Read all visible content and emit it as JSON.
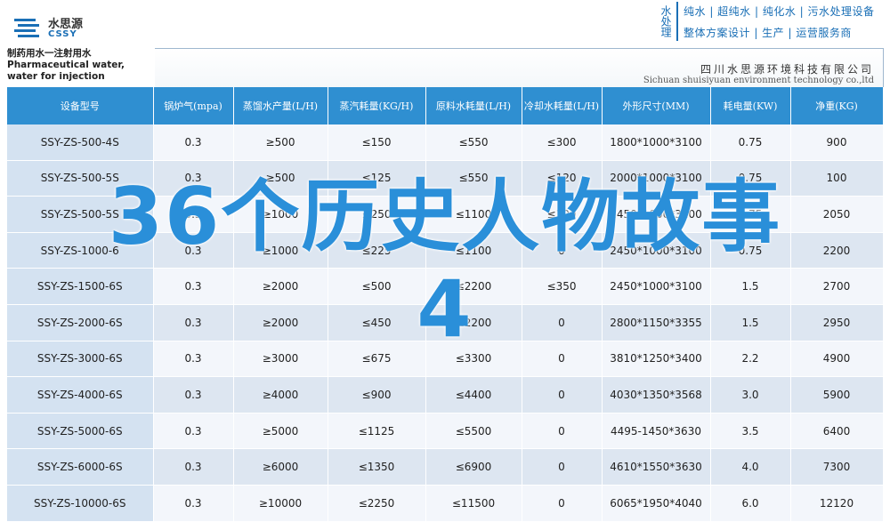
{
  "brand": {
    "name_cn": "水思源",
    "name_en": "CSSY"
  },
  "header": {
    "side_tag": "水处理",
    "line1": "纯水 | 超纯水 | 纯化水 | 污水处理设备",
    "line2": "整体方案设计 | 生产 | 运营服务商"
  },
  "product": {
    "title_cn": "制药用水一注射用水",
    "title_en": "Pharmaceutical water, water for injection",
    "company_cn": "四川水思源环境科技有限公司",
    "company_en": "Sichuan shuisiyuan environment technology co.,ltd"
  },
  "table": {
    "headers": [
      "设备型号",
      "锅炉气(mpa)",
      "蒸馏水产量(L/H)",
      "蒸汽耗量(KG/H)",
      "原料水耗量(L/H)",
      "冷却水耗量(L/H)",
      "外形尺寸(MM)",
      "耗电量(KW)",
      "净重(KG)"
    ],
    "rows": [
      [
        "SSY-ZS-500-4S",
        "0.3",
        "≥500",
        "≤150",
        "≤550",
        "≤300",
        "1800*1000*3100",
        "0.75",
        "900"
      ],
      [
        "SSY-ZS-500-5S",
        "0.3",
        "≥500",
        "≤125",
        "≤550",
        "≤120",
        "2000*1000*3100",
        "0.75",
        "100"
      ],
      [
        "SSY-ZS-500-5S",
        "0.3",
        "≥1000",
        "≤250",
        "≤1100",
        "≤300",
        "2450*1000*3100",
        "0.75",
        "2050"
      ],
      [
        "SSY-ZS-1000-6",
        "0.3",
        "≥1000",
        "≤225",
        "≤1100",
        "0",
        "2450*1000*3100",
        "0.75",
        "2200"
      ],
      [
        "SSY-ZS-1500-6S",
        "0.3",
        "≥2000",
        "≤500",
        "≤2200",
        "≤350",
        "2450*1000*3100",
        "1.5",
        "2700"
      ],
      [
        "SSY-ZS-2000-6S",
        "0.3",
        "≥2000",
        "≤450",
        "≤2200",
        "0",
        "2800*1150*3355",
        "1.5",
        "2950"
      ],
      [
        "SSY-ZS-3000-6S",
        "0.3",
        "≥3000",
        "≤675",
        "≤3300",
        "0",
        "3810*1250*3400",
        "2.2",
        "4900"
      ],
      [
        "SSY-ZS-4000-6S",
        "0.3",
        "≥4000",
        "≤900",
        "≤4400",
        "0",
        "4030*1350*3568",
        "3.0",
        "5900"
      ],
      [
        "SSY-ZS-5000-6S",
        "0.3",
        "≥5000",
        "≤1125",
        "≤5500",
        "0",
        "4495-1450*3630",
        "3.5",
        "6400"
      ],
      [
        "SSY-ZS-6000-6S",
        "0.3",
        "≥6000",
        "≤1350",
        "≤6900",
        "0",
        "4610*1550*3630",
        "4.0",
        "7300"
      ],
      [
        "SSY-ZS-10000-6S",
        "0.3",
        "≥10000",
        "≤2250",
        "≤11500",
        "0",
        "6065*1950*4040",
        "6.0",
        "12120"
      ]
    ]
  },
  "overlay": {
    "line1": "36个历史人物故事",
    "line2": "4"
  },
  "colors": {
    "header_blue": "#2f8fd1",
    "brand_blue": "#1a6fb6",
    "row_light": "#f3f6fb",
    "row_dark": "#dde6f1",
    "overlay_blue": "#2a8fd9"
  }
}
